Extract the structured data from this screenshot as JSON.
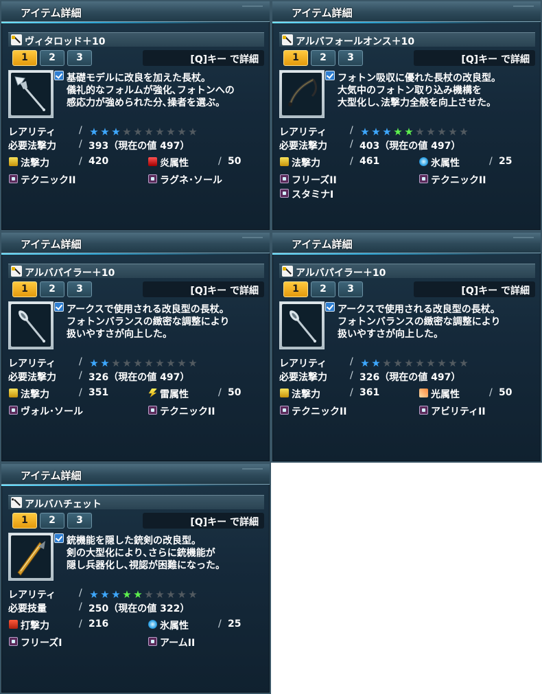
{
  "panels": [
    {
      "header": "アイテム詳細",
      "name": "ヴィタロッド＋10",
      "tabs": [
        "1",
        "2",
        "3"
      ],
      "detail": "[Q]キー で詳細",
      "desc": [
        "基礎モデルに改良を加えた長杖。",
        "儀礼的なフォルムが強化､フォトンへの",
        "感応力が強められた分､操者を選ぶ。"
      ],
      "rarity_label": "レアリティ",
      "rarity": 3,
      "req_label": "必要法撃力",
      "req_value": "393（現在の値 497）",
      "attack_label": "法撃力",
      "attack_value": "420",
      "element_label": "炎属性",
      "element_value": "50",
      "abilities": [
        "テクニックII",
        "ラグネ･ソール"
      ]
    },
    {
      "header": "アイテム詳細",
      "name": "アルバフォールオンス＋10",
      "tabs": [
        "1",
        "2",
        "3"
      ],
      "detail": "[Q]キー で詳細",
      "desc": [
        "フォトン吸収に優れた長杖の改良型。",
        "大気中のフォトン取り込み機構を",
        "大型化し､法撃力全般を向上させた。"
      ],
      "rarity_label": "レアリティ",
      "rarity": 5,
      "req_label": "必要法撃力",
      "req_value": "403（現在の値 497）",
      "attack_label": "法撃力",
      "attack_value": "461",
      "element_label": "氷属性",
      "element_value": "25",
      "abilities": [
        "フリーズII",
        "テクニックII",
        "スタミナI"
      ]
    },
    {
      "header": "アイテム詳細",
      "name": "アルバパイラー＋10",
      "tabs": [
        "1",
        "2",
        "3"
      ],
      "detail": "[Q]キー で詳細",
      "desc": [
        "アークスで使用される改良型の長杖。",
        "フォトンバランスの緻密な調整により",
        "扱いやすさが向上した。"
      ],
      "rarity_label": "レアリティ",
      "rarity": 2,
      "req_label": "必要法撃力",
      "req_value": "326（現在の値 497）",
      "attack_label": "法撃力",
      "attack_value": "351",
      "element_label": "雷属性",
      "element_value": "50",
      "abilities": [
        "ヴォル･ソール",
        "テクニックII"
      ]
    },
    {
      "header": "アイテム詳細",
      "name": "アルバパイラー＋10",
      "tabs": [
        "1",
        "2",
        "3"
      ],
      "detail": "[Q]キー で詳細",
      "desc": [
        "アークスで使用される改良型の長杖。",
        "フォトンバランスの緻密な調整により",
        "扱いやすさが向上した。"
      ],
      "rarity_label": "レアリティ",
      "rarity": 2,
      "req_label": "必要法撃力",
      "req_value": "326（現在の値 497）",
      "attack_label": "法撃力",
      "attack_value": "361",
      "element_label": "光属性",
      "element_value": "50",
      "abilities": [
        "テクニックII",
        "アビリティII"
      ]
    },
    {
      "header": "アイテム詳細",
      "name": "アルバハチェット",
      "tabs": [
        "1",
        "2",
        "3"
      ],
      "detail": "[Q]キー で詳細",
      "desc": [
        "銃機能を隠した銃剣の改良型。",
        "剣の大型化により､さらに銃機能が",
        "隠し兵器化し､視認が困難になった。"
      ],
      "rarity_label": "レアリティ",
      "rarity": 5,
      "req_label": "必要技量",
      "req_value": "250（現在の値 322）",
      "attack_label": "打撃力",
      "attack_value": "216",
      "element_label": "氷属性",
      "element_value": "25",
      "abilities": [
        "フリーズI",
        "アームII"
      ]
    }
  ]
}
